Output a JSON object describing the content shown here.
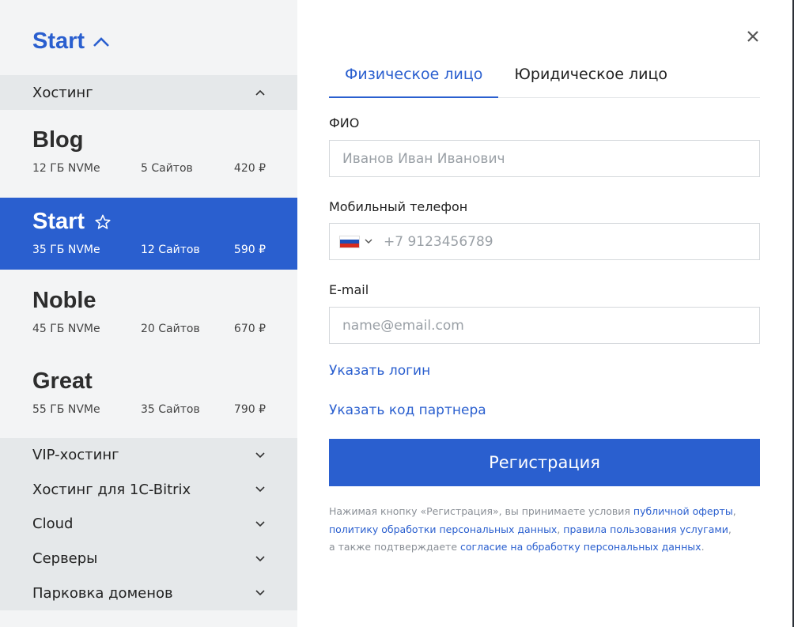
{
  "left": {
    "current_plan": "Start",
    "sections": {
      "hosting": "Хостинг"
    },
    "tariffs": [
      {
        "name": "Blog",
        "disk": "12 ГБ NVMe",
        "sites": "5 Сайтов",
        "price": "420 ₽"
      },
      {
        "name": "Start",
        "disk": "35 ГБ NVMe",
        "sites": "12 Сайтов",
        "price": "590 ₽"
      },
      {
        "name": "Noble",
        "disk": "45 ГБ NVMe",
        "sites": "20 Сайтов",
        "price": "670 ₽"
      },
      {
        "name": "Great",
        "disk": "55 ГБ NVMe",
        "sites": "35 Сайтов",
        "price": "790 ₽"
      }
    ],
    "other_sections": [
      "VIP-хостинг",
      "Хостинг для 1C-Bitrix",
      "Cloud",
      "Серверы",
      "Парковка доменов"
    ]
  },
  "form": {
    "tabs": [
      "Физическое лицо",
      "Юридическое лицо"
    ],
    "fio_label": "ФИО",
    "fio_placeholder": "Иванов Иван Иванович",
    "phone_label": "Мобильный телефон",
    "phone_placeholder": "+7 9123456789",
    "email_label": "E-mail",
    "email_placeholder": "name@email.com",
    "login_link": "Указать логин",
    "partner_link": "Указать код партнера",
    "submit_label": "Регистрация",
    "legal": {
      "p1": "Нажимая кнопку «Регистрация», вы принимаете условия ",
      "l1": "публичной оферты",
      "p2": ",",
      "l2": "политику обработки персональных данных",
      "p3": ", ",
      "l3": "правила пользования услугами",
      "p4": ",",
      "p5": "а также подтверждаете ",
      "l4": "согласие на обработку персональных данных",
      "p6": "."
    }
  },
  "colors": {
    "accent": "#2a5fcf",
    "panel_bg": "#f3f4f5",
    "section_bg": "#e5e8ea"
  }
}
